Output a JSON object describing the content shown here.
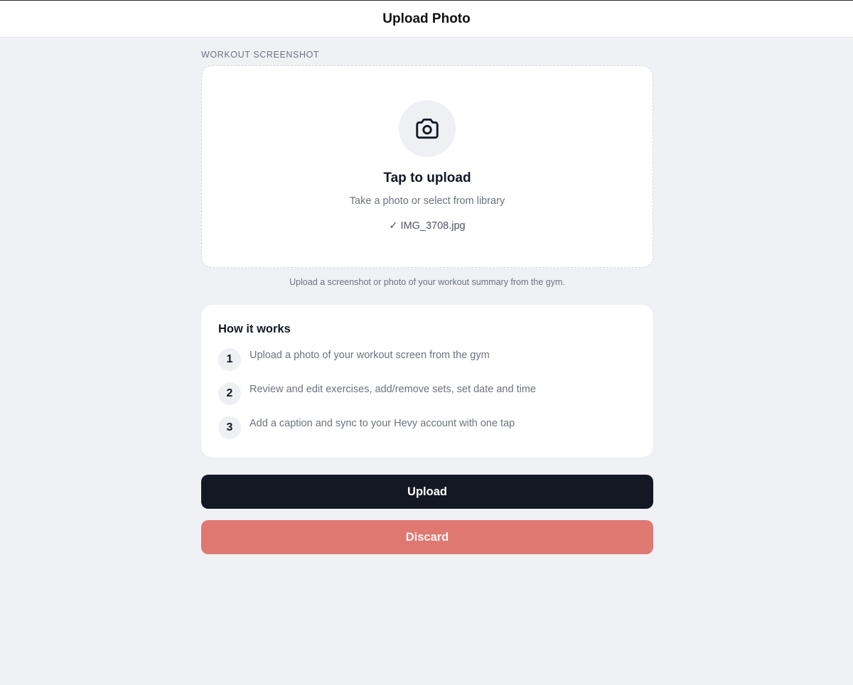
{
  "header": {
    "title": "Upload Photo"
  },
  "upload": {
    "section_label": "WORKOUT SCREENSHOT",
    "icon": "camera-icon",
    "title": "Tap to upload",
    "subtitle": "Take a photo or select from library",
    "selected_file": "✓ IMG_3708.jpg",
    "hint": "Upload a screenshot or photo of your workout summary from the gym."
  },
  "how_it_works": {
    "title": "How it works",
    "steps": [
      {
        "number": "1",
        "text": "Upload a photo of your workout screen from the gym"
      },
      {
        "number": "2",
        "text": "Review and edit exercises, add/remove sets, set date and time"
      },
      {
        "number": "3",
        "text": "Add a caption and sync to your Hevy account with one tap"
      }
    ]
  },
  "actions": {
    "upload_label": "Upload",
    "discard_label": "Discard"
  },
  "colors": {
    "background": "#f0f1f5",
    "primary_button": "#141824",
    "discard_button": "#e07872"
  }
}
